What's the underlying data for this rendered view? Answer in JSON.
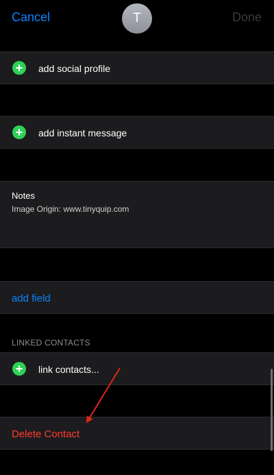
{
  "nav": {
    "cancel_label": "Cancel",
    "avatar_initial": "T",
    "done_label": "Done"
  },
  "rows": {
    "social_profile": "add social profile",
    "instant_message": "add instant message"
  },
  "notes": {
    "label": "Notes",
    "value": "Image Origin: www.tinyquip.com"
  },
  "add_field_label": "add field",
  "linked_contacts": {
    "header": "LINKED CONTACTS",
    "link_label": "link contacts..."
  },
  "delete_label": "Delete Contact",
  "colors": {
    "accent": "#0a84ff",
    "add_green": "#30d158",
    "destructive": "#ff3b30",
    "annotation_arrow": "#e0261a"
  }
}
